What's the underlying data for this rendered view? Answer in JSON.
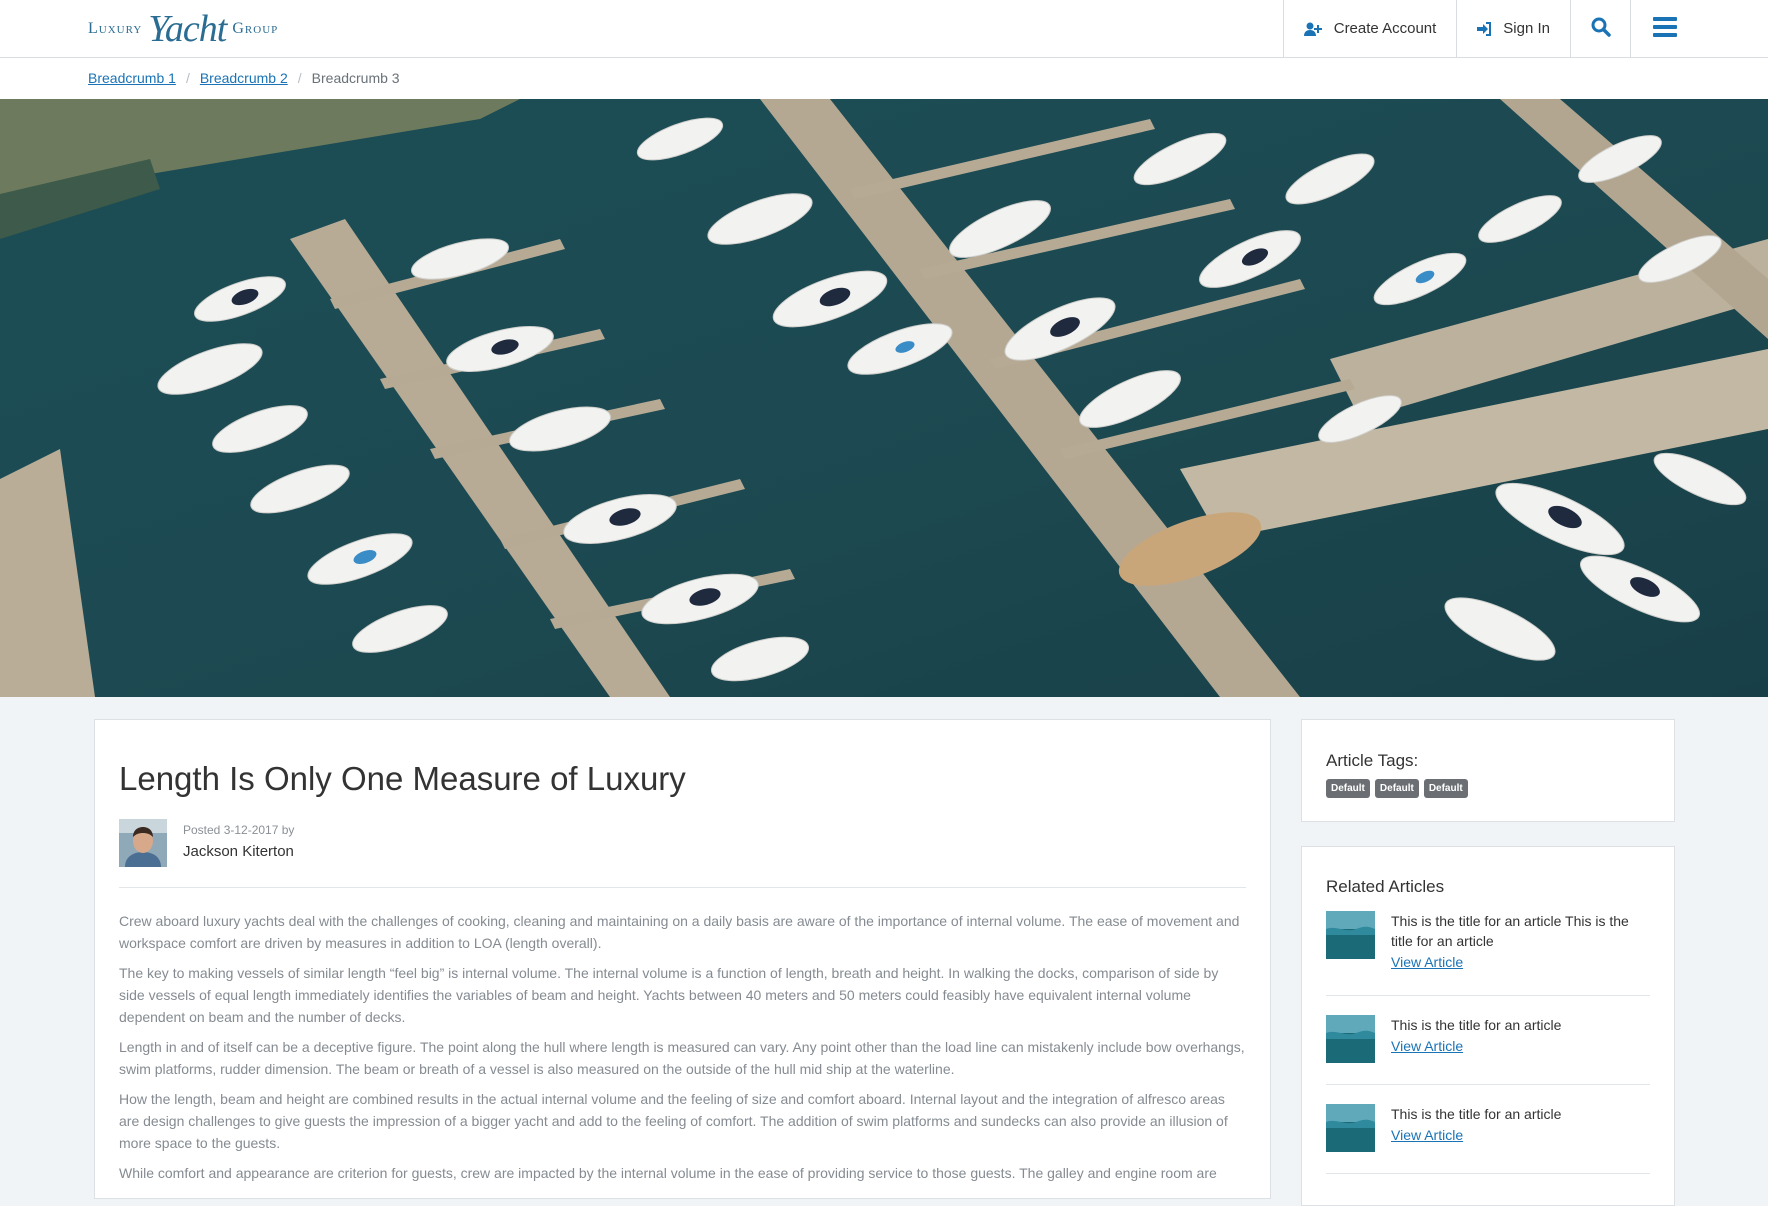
{
  "header": {
    "logo": {
      "word_left": "Luxury",
      "word_script": "Yacht",
      "word_right": "Group"
    },
    "nav": {
      "create_account": "Create Account",
      "sign_in": "Sign In"
    }
  },
  "breadcrumb": {
    "items": [
      "Breadcrumb 1",
      "Breadcrumb 2"
    ],
    "current": "Breadcrumb 3",
    "separator": "/"
  },
  "article": {
    "title": "Length Is Only One Measure of Luxury",
    "posted": "Posted 3-12-2017 by",
    "author": "Jackson Kiterton",
    "paragraphs": [
      "Crew aboard luxury yachts deal with the challenges of cooking, cleaning and maintaining on a daily basis are aware of the importance of internal volume. The ease of movement and workspace comfort are driven by measures in addition to LOA (length overall).",
      "The key to making vessels of similar length “feel big” is internal volume. The internal volume is a function of length, breath and height. In walking the docks, comparison of side by side vessels of equal length immediately identifies the variables of beam and height. Yachts between 40 meters and 50 meters could feasibly have equivalent internal volume dependent on beam and the number of decks.",
      "Length in and of itself can be a deceptive figure. The point along the hull where length is measured can vary. Any point other than the load line can mistakenly include bow overhangs, swim platforms, rudder dimension. The beam or breath of a vessel is also measured on the outside of the hull mid ship at the waterline.",
      "How the length, beam and height are combined results in the actual internal volume and the feeling of size and comfort aboard. Internal layout and the integration of alfresco areas are design challenges to give guests the impression of a bigger yacht and add to the feeling of comfort. The addition of swim platforms and sundecks can also provide an illusion of more space to the guests.",
      "While comfort and appearance are criterion for guests, crew are impacted by the internal volume in the ease of providing service to those guests. The galley and engine room are"
    ]
  },
  "sidebar": {
    "tags_label": "Article Tags:",
    "tags": [
      "Default",
      "Default",
      "Default"
    ],
    "related_title": "Related Articles",
    "related": [
      {
        "title": "This is the title for an article This is the title for an article",
        "link": "View Article"
      },
      {
        "title": "This is the title for an article",
        "link": "View Article"
      },
      {
        "title": "This is the title for an article",
        "link": "View Article"
      }
    ]
  },
  "colors": {
    "accent": "#1a73b5",
    "tag_bg": "#6b6f73",
    "page_bg": "#f1f4f7",
    "water": "#1f4a52"
  },
  "icons": [
    "user-plus-icon",
    "sign-in-icon",
    "search-icon",
    "hamburger-menu-icon"
  ]
}
